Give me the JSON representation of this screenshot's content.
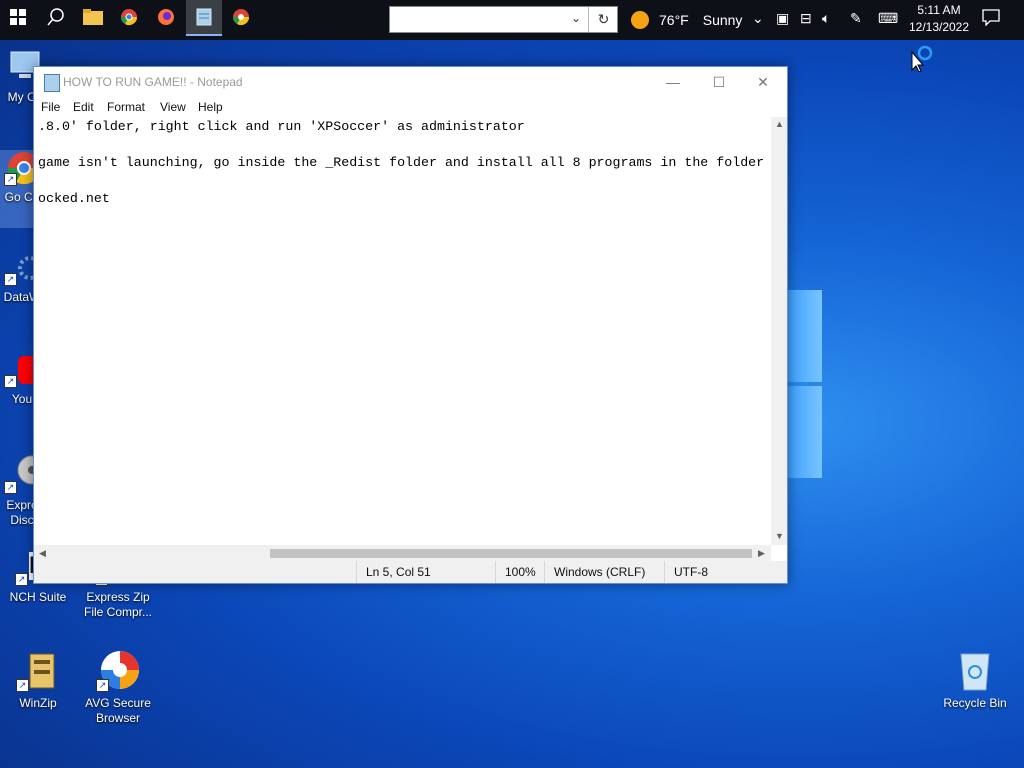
{
  "taskbar": {
    "search_value": "",
    "weather_temp": "76°F",
    "weather_cond": "Sunny",
    "clock_time": "5:11 AM",
    "clock_date": "12/13/2022"
  },
  "desktop_icons": {
    "my_computer": "My Co",
    "chrome": "Go Ch",
    "datawatch": "DataW",
    "youtube": "You",
    "express_disc": "Expre Disc",
    "nch": "NCH Suite",
    "nch_logo": "NC",
    "express_zip": "Express Zip File Compr...",
    "winzip": "WinZip",
    "avg": "AVG Secure Browser",
    "recycle": "Recycle Bin"
  },
  "notepad": {
    "title": "HOW TO RUN GAME!! - Notepad",
    "menu": [
      "File",
      "Edit",
      "Format",
      "View",
      "Help"
    ],
    "lines": [
      ".8.0' folder, right click and run 'XPSoccer' as administrator",
      "",
      "game isn't launching, go inside the _Redist folder and install all 8 programs in the folder",
      "",
      "ocked.net"
    ],
    "status": {
      "position": "Ln 5, Col 51",
      "zoom": "100%",
      "line_ending": "Windows (CRLF)",
      "encoding": "UTF-8"
    }
  },
  "colors": {
    "taskbar": "#0d1117",
    "desktop": "#1565d6",
    "weather_sun": "#f6a313"
  }
}
